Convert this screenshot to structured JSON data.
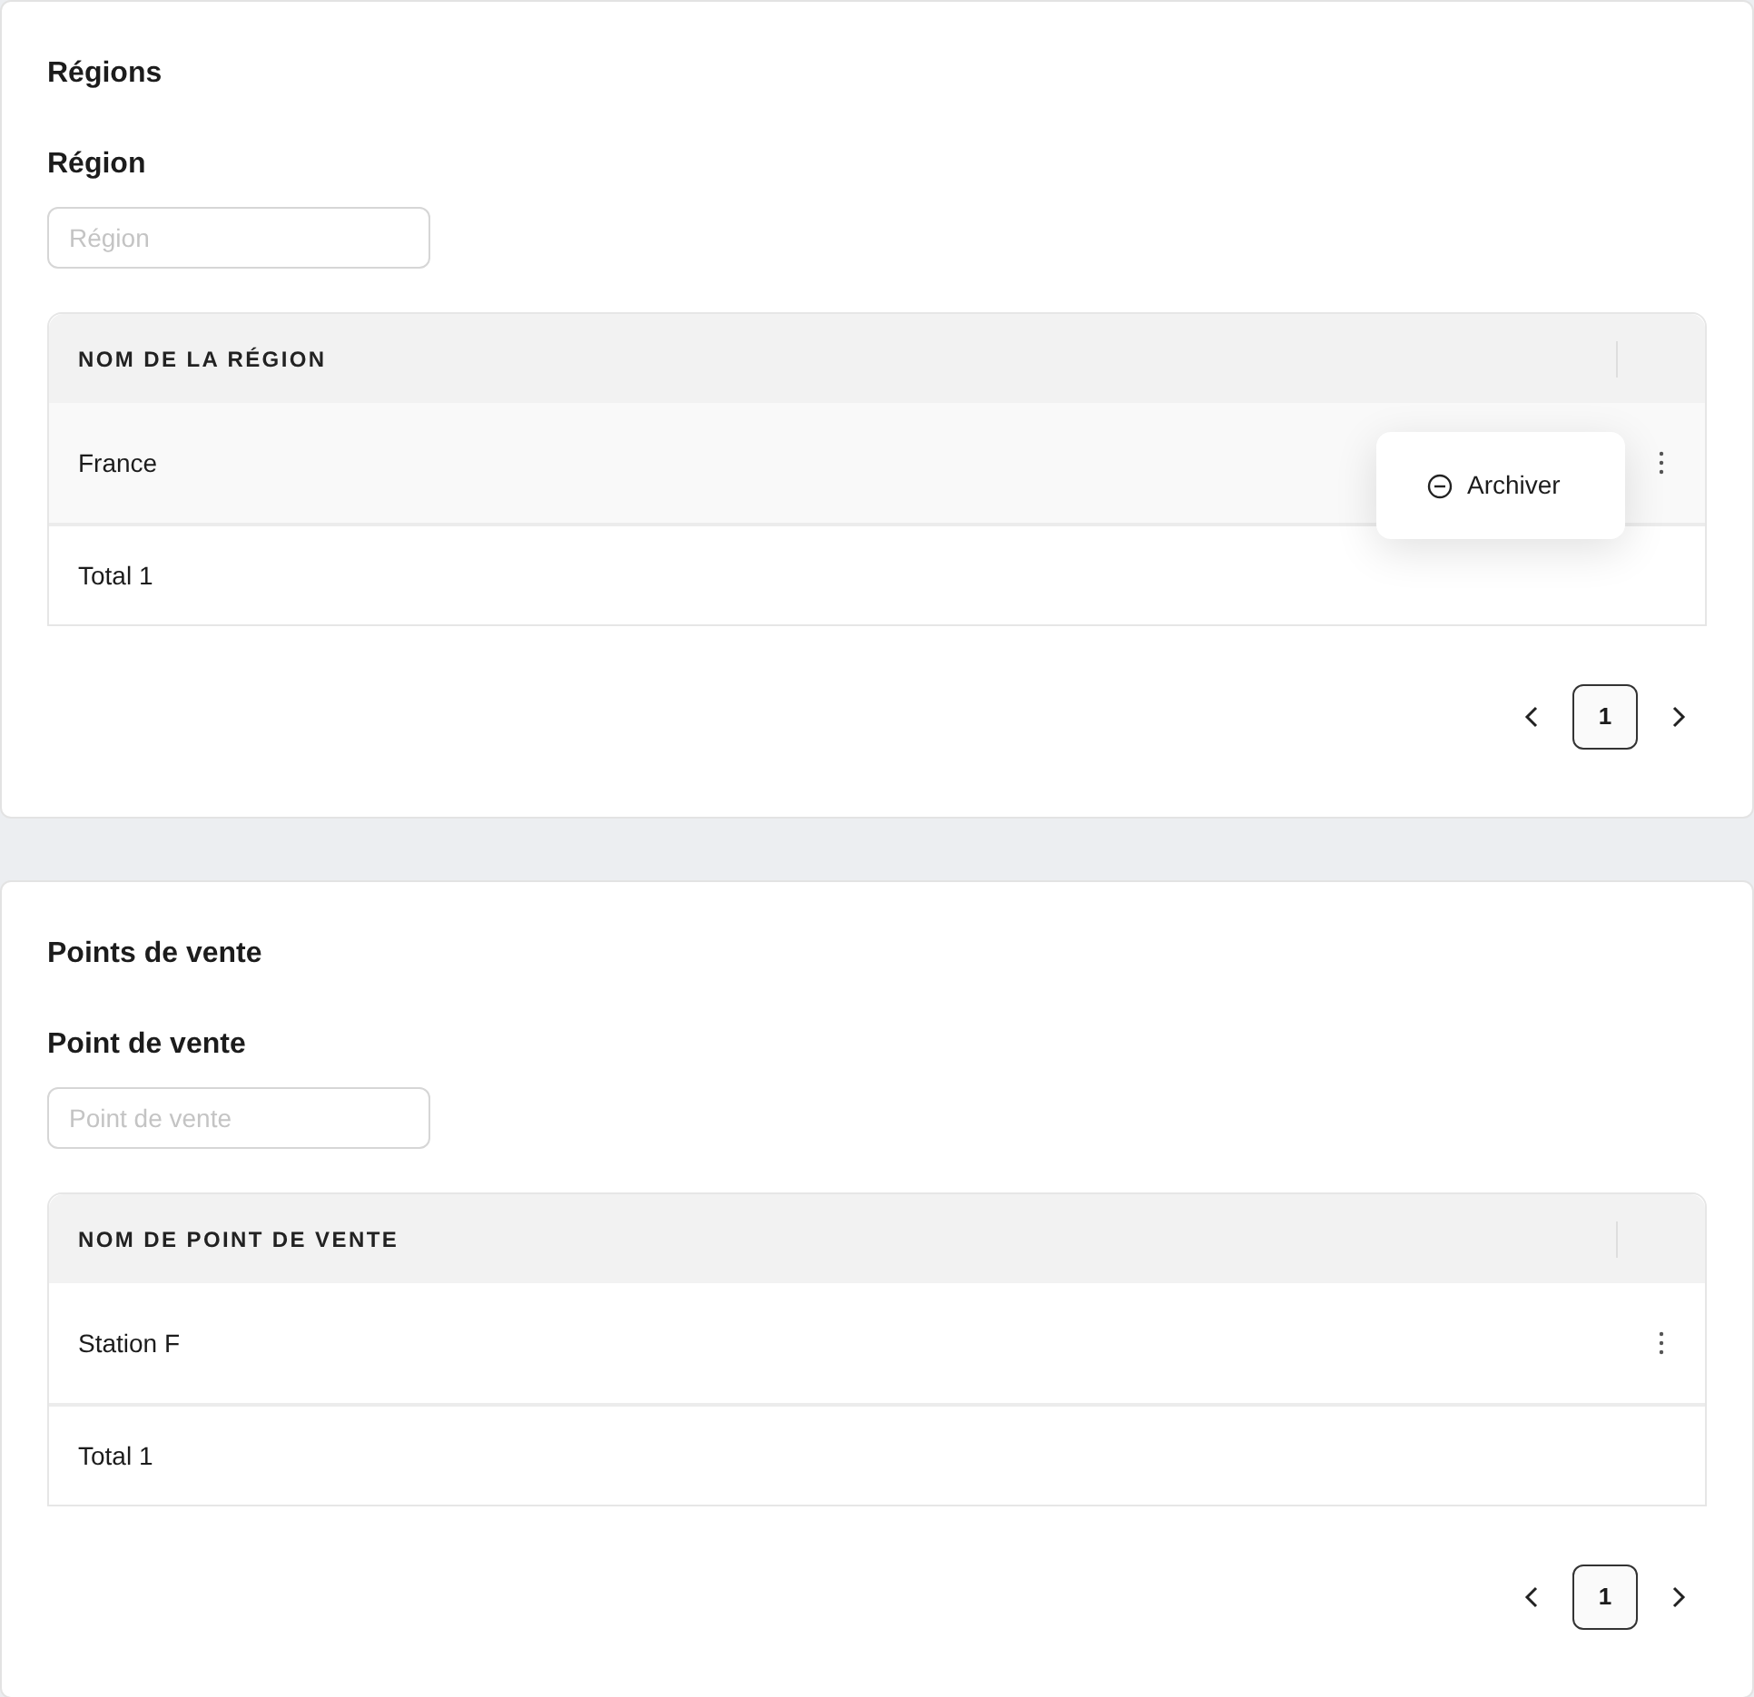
{
  "sections": [
    {
      "title": "Régions",
      "filter": {
        "label": "Région",
        "placeholder": "Région"
      },
      "table": {
        "columns": [
          "NOM DE LA RÉGION"
        ],
        "rows": [
          {
            "cells": [
              "France"
            ],
            "menu": [
              {
                "label": "Archiver"
              }
            ]
          }
        ],
        "footer": "Total 1"
      },
      "pagination": {
        "pages": [
          {
            "label": "1",
            "selected": true
          }
        ]
      }
    },
    {
      "title": "Points de vente",
      "filter": {
        "label": "Point de vente",
        "placeholder": "Point de vente"
      },
      "table": {
        "columns": [
          "NOM DE POINT DE VENTE"
        ],
        "rows": [
          {
            "cells": [
              "Station F"
            ]
          }
        ],
        "footer": "Total 1"
      },
      "pagination": {
        "pages": [
          {
            "label": "1",
            "selected": true
          }
        ]
      }
    }
  ]
}
